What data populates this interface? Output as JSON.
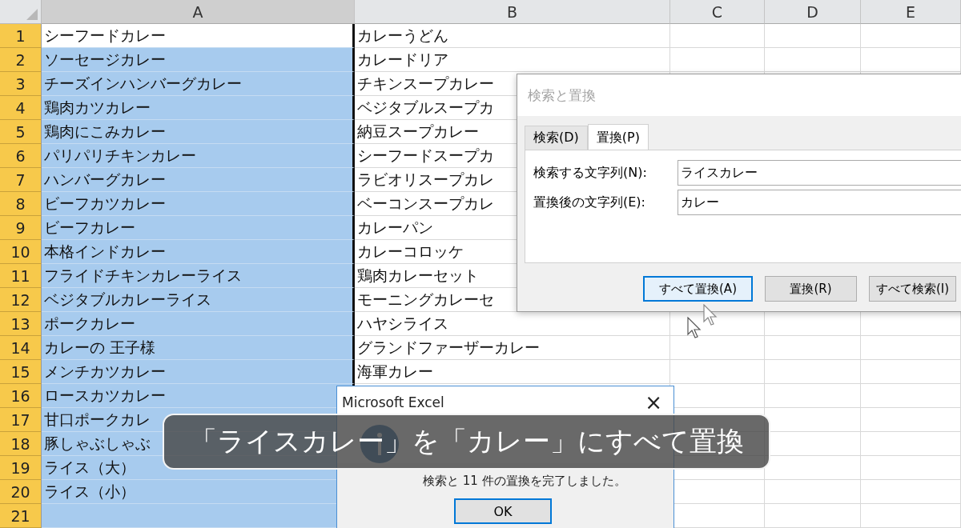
{
  "sheet": {
    "columns": [
      {
        "label": "A",
        "selected": true
      },
      {
        "label": "B",
        "selected": false
      },
      {
        "label": "C",
        "selected": false
      },
      {
        "label": "D",
        "selected": false
      },
      {
        "label": "E",
        "selected": false
      }
    ],
    "rows": [
      {
        "number": "1",
        "selected": true,
        "active": true,
        "a": "シーフードカレー",
        "b": "カレーうどん"
      },
      {
        "number": "2",
        "selected": true,
        "active": false,
        "a": "ソーセージカレー",
        "b": "カレードリア"
      },
      {
        "number": "3",
        "selected": true,
        "active": false,
        "a": "チーズインハンバーグカレー",
        "b": "チキンスープカレー"
      },
      {
        "number": "4",
        "selected": true,
        "active": false,
        "a": "鶏肉カツカレー",
        "b": "ベジタブルスープカ"
      },
      {
        "number": "5",
        "selected": true,
        "active": false,
        "a": "鶏肉にこみカレー",
        "b": "納豆スープカレー"
      },
      {
        "number": "6",
        "selected": true,
        "active": false,
        "a": "パリパリチキンカレー",
        "b": "シーフードスープカ"
      },
      {
        "number": "7",
        "selected": true,
        "active": false,
        "a": "ハンバーグカレー",
        "b": "ラビオリスープカレ"
      },
      {
        "number": "8",
        "selected": true,
        "active": false,
        "a": "ビーフカツカレー",
        "b": "ベーコンスープカレ"
      },
      {
        "number": "9",
        "selected": true,
        "active": false,
        "a": "ビーフカレー",
        "b": "カレーパン"
      },
      {
        "number": "10",
        "selected": true,
        "active": false,
        "a": "本格インドカレー",
        "b": "カレーコロッケ"
      },
      {
        "number": "11",
        "selected": true,
        "active": false,
        "a": "フライドチキンカレーライス",
        "b": "鶏肉カレーセット"
      },
      {
        "number": "12",
        "selected": true,
        "active": false,
        "a": "ベジタブルカレーライス",
        "b": "モーニングカレーセ"
      },
      {
        "number": "13",
        "selected": true,
        "active": false,
        "a": "ポークカレー",
        "b": "ハヤシライス"
      },
      {
        "number": "14",
        "selected": true,
        "active": false,
        "a": "カレーの 王子様",
        "b": "グランドファーザーカレー"
      },
      {
        "number": "15",
        "selected": true,
        "active": false,
        "a": "メンチカツカレー",
        "b": "海軍カレー"
      },
      {
        "number": "16",
        "selected": true,
        "active": false,
        "a": "ロースカツカレー"
      },
      {
        "number": "17",
        "selected": true,
        "active": false,
        "a": "甘口ポークカレ"
      },
      {
        "number": "18",
        "selected": true,
        "active": false,
        "a": "豚しゃぶしゃぶ"
      },
      {
        "number": "19",
        "selected": true,
        "active": false,
        "a": "ライス（大）"
      },
      {
        "number": "20",
        "selected": true,
        "active": false,
        "a": "ライス（小）"
      },
      {
        "number": "21",
        "selected": true,
        "active": false
      }
    ]
  },
  "find_replace_dialog": {
    "title": "検索と置換",
    "tabs": [
      {
        "label": "検索(D)",
        "selected": false
      },
      {
        "label": "置換(P)",
        "selected": true
      }
    ],
    "fields": [
      {
        "label": "検索する文字列(N):",
        "value": "ライスカレー"
      },
      {
        "label": "置換後の文字列(E):",
        "value": "カレー"
      }
    ],
    "buttons": [
      {
        "label": "すべて置換(A)",
        "default": true
      },
      {
        "label": "置換(R)",
        "default": false
      },
      {
        "label": "すべて検索(I)",
        "default": false
      }
    ]
  },
  "message_box": {
    "title": "Microsoft Excel",
    "close": "×",
    "message": "検索と 11 件の置換を完了しました。",
    "button": "OK"
  },
  "caption": "「ライスカレー」を「カレー」にすべて置換"
}
